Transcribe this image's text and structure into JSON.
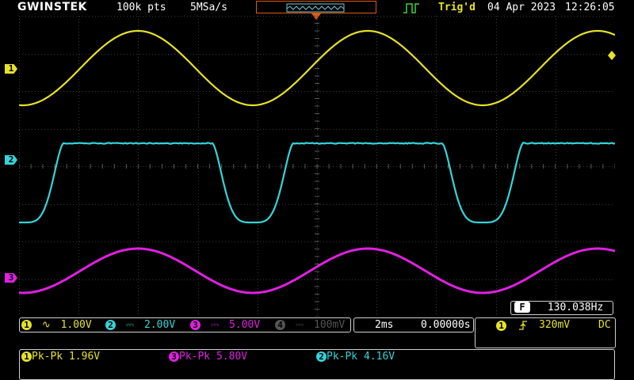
{
  "header": {
    "brand": "GWINSTEK",
    "record_length": "100k pts",
    "sample_rate": "5MSa/s",
    "trigger_status": "Trig'd",
    "date": "04 Apr 2023",
    "time": "12:26:05"
  },
  "channels": [
    {
      "id": "1",
      "color": "#e6e22a",
      "coupling_icon": "ac-wave-icon",
      "scale": "1.00V",
      "enabled": true
    },
    {
      "id": "2",
      "color": "#35d4d8",
      "coupling_icon": "dc-icon",
      "scale": "2.00V",
      "enabled": true
    },
    {
      "id": "3",
      "color": "#e020e0",
      "coupling_icon": "dc-icon",
      "scale": "5.00V",
      "enabled": true
    },
    {
      "id": "4",
      "color": "#555555",
      "coupling_icon": "dc-icon",
      "scale": "100mV",
      "enabled": false
    }
  ],
  "timebase": {
    "scale": "2ms",
    "position": "0.00000s"
  },
  "trigger": {
    "source": "1",
    "slope_icon": "rising-edge-icon",
    "level": "320mV",
    "coupling": "DC"
  },
  "frequency": {
    "badge": "F",
    "value": "130.038Hz"
  },
  "measurements": [
    {
      "channel": "1",
      "label": "Pk-Pk",
      "value": "1.96V",
      "color": "#e6e22a"
    },
    {
      "channel": "3",
      "label": "Pk-Pk",
      "value": "5.80V",
      "color": "#e020e0"
    },
    {
      "channel": "2",
      "label": "Pk-Pk",
      "value": "4.16V",
      "color": "#35d4d8"
    }
  ],
  "colors": {
    "grid": "#3a3a3a",
    "grid_dot": "#5a5a5a",
    "accent": "#e05a10",
    "trig_green": "#3dd13d"
  }
}
